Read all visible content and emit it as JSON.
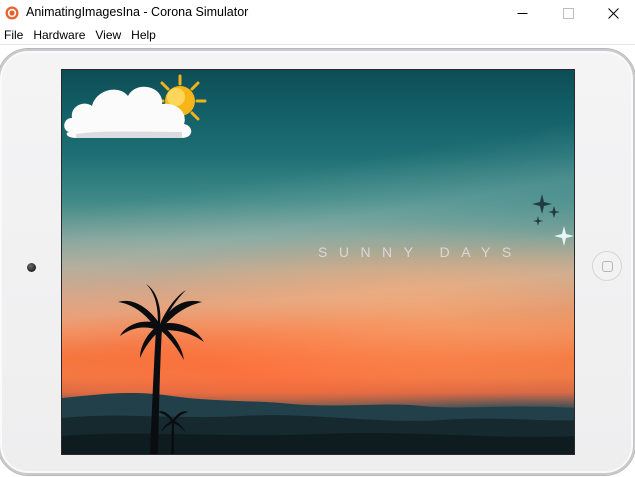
{
  "window": {
    "title": "AnimatingImagesIna - Corona Simulator",
    "app_icon": "corona-icon",
    "controls": {
      "minimize_icon": "minimize-icon",
      "maximize_icon": "maximize-icon",
      "close_icon": "close-icon"
    }
  },
  "menubar": {
    "items": [
      {
        "label": "File"
      },
      {
        "label": "Hardware"
      },
      {
        "label": "View"
      },
      {
        "label": "Help"
      }
    ]
  },
  "device": {
    "model": "tablet",
    "orientation": "landscape",
    "camera_icon": "front-camera-icon",
    "home_button_icon": "home-button-icon"
  },
  "screen": {
    "overlay_text": "SUNNY DAYS",
    "images": [
      "cloud-icon",
      "sun-icon",
      "sparkle-stars-icon",
      "palm-tree-icon"
    ],
    "colors": {
      "sky_top": "#0d4d55",
      "sunset_orange": "#f4773f",
      "text": "#e1e1e1"
    }
  }
}
